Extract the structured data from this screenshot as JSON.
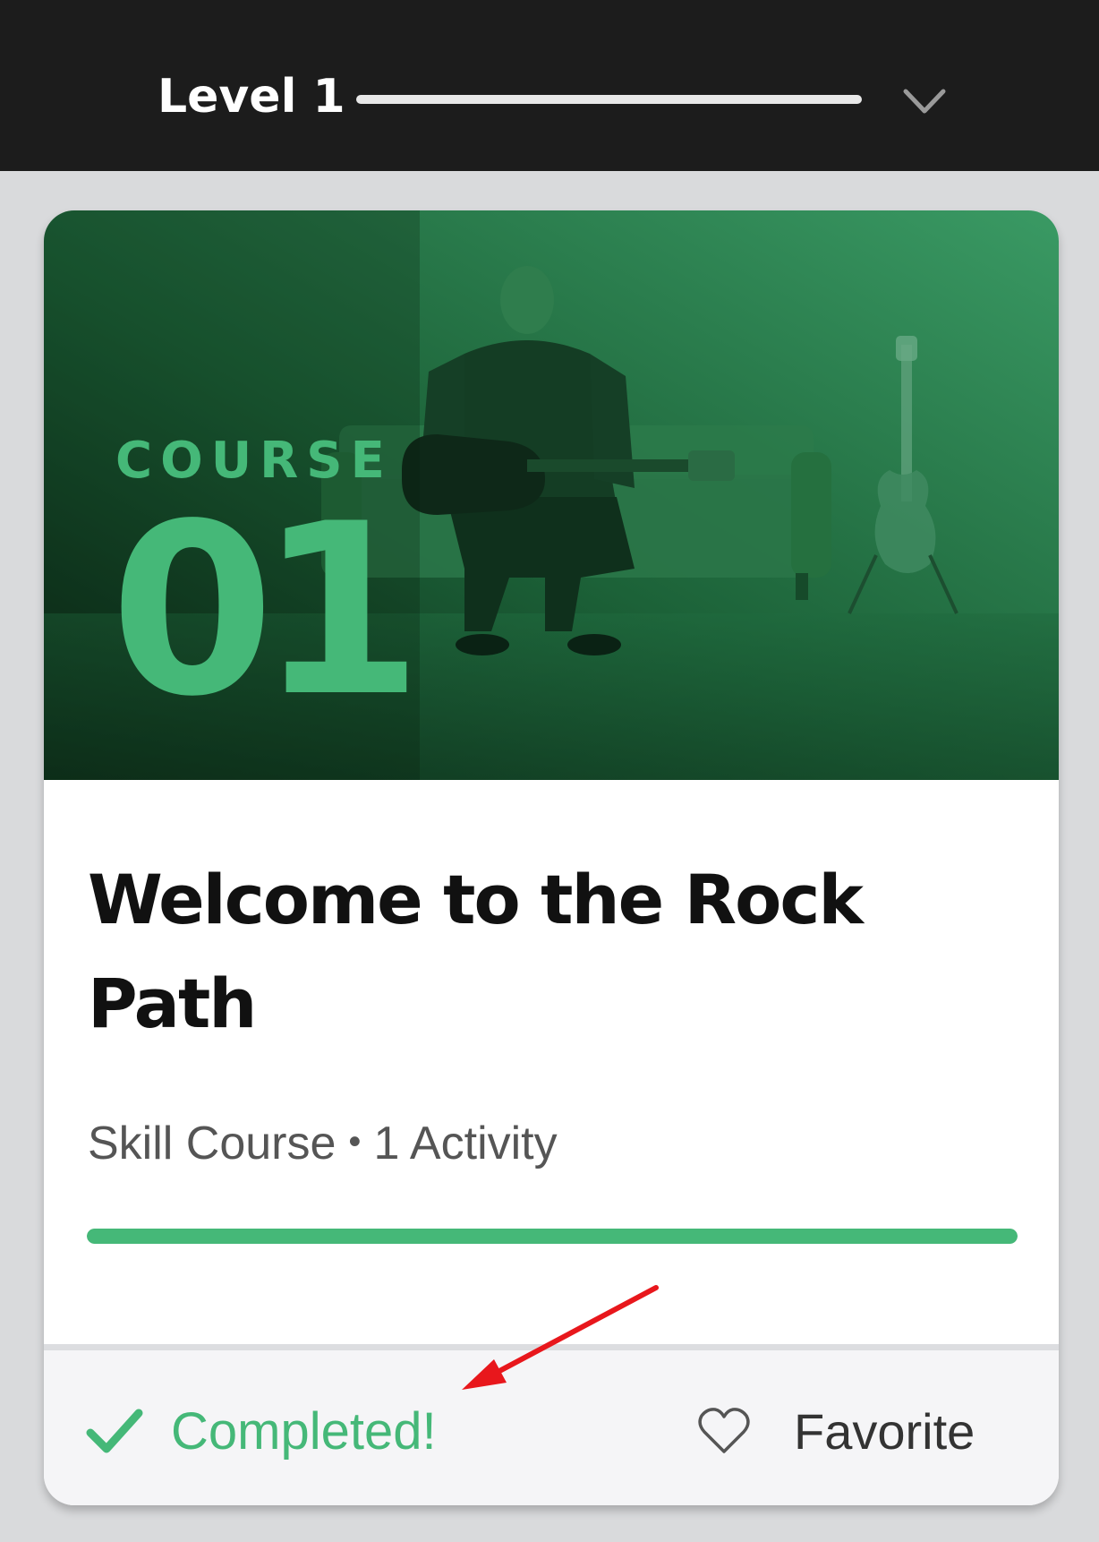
{
  "header": {
    "level_title": "Level 1",
    "level_progress": 1.0
  },
  "course_card": {
    "hero": {
      "label": "COURSE",
      "number": "01"
    },
    "title": "Welcome to the Rock Path",
    "meta": {
      "type": "Skill Course",
      "separator": "•",
      "activities": "1 Activity"
    },
    "progress": 1.0,
    "footer": {
      "status_label": "Completed!",
      "favorite_label": "Favorite"
    }
  },
  "icons": {
    "chevron": "chevron-down-icon",
    "check": "check-icon",
    "heart": "heart-outline-icon"
  },
  "colors": {
    "accent": "#45b878",
    "header_bg": "#1c1c1c",
    "page_bg": "#d9dadc",
    "hero_dark": "#0c2a18",
    "hero_light": "#2f8a57",
    "annotation": "#e8171c"
  }
}
